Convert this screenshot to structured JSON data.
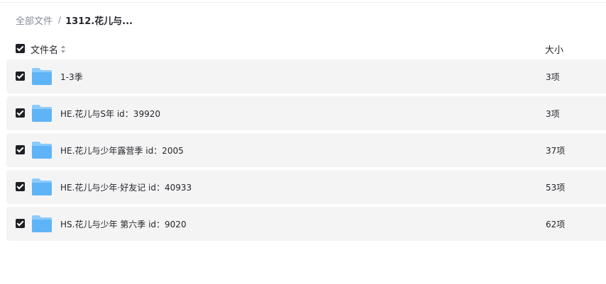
{
  "breadcrumb": {
    "root": "全部文件",
    "separator": "/",
    "current": "1312.花儿与..."
  },
  "header": {
    "name_label": "文件名",
    "size_label": "大小",
    "all_checked": true
  },
  "colors": {
    "row_bg": "#f4f4f5",
    "checkbox": "#1e1f24",
    "folder_front": "#5fb4f7",
    "folder_back": "#8ccbfb"
  },
  "files": [
    {
      "name": "1-3季",
      "size": "3项",
      "type": "folder-icon",
      "checked": true
    },
    {
      "name": "HE.花儿与S年 id：39920",
      "size": "3项",
      "type": "folder-icon",
      "checked": true
    },
    {
      "name": "HE.花儿与少年露营季 id：2005",
      "size": "37项",
      "type": "folder-icon",
      "checked": true
    },
    {
      "name": "HE.花儿与少年·好友记 id：40933",
      "size": "53项",
      "type": "folder-icon",
      "checked": true
    },
    {
      "name": "HS.花儿与少年 第六季 id：9020",
      "size": "62项",
      "type": "folder-icon",
      "checked": true
    }
  ]
}
